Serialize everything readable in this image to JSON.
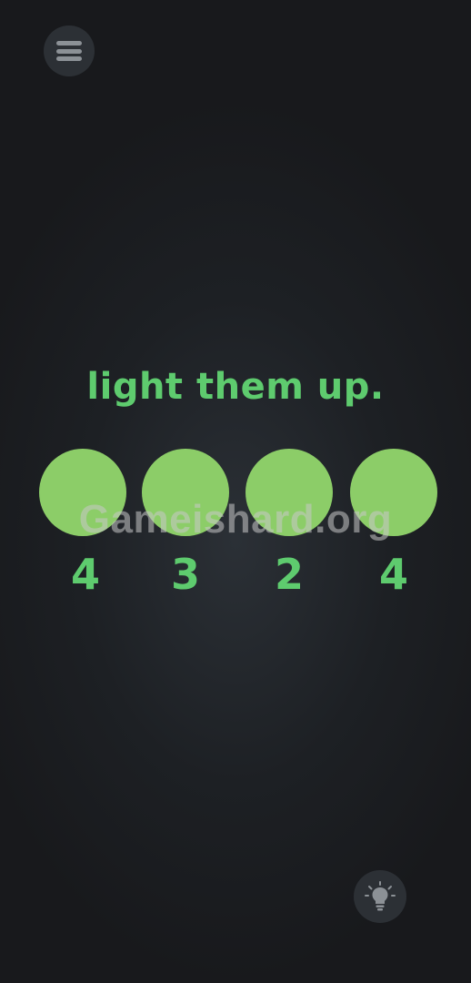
{
  "header": {
    "menu_icon": "menu-icon"
  },
  "puzzle": {
    "title": "light them up.",
    "bulbs": [
      {
        "count": "4",
        "lit": true
      },
      {
        "count": "3",
        "lit": true
      },
      {
        "count": "2",
        "lit": true
      },
      {
        "count": "4",
        "lit": true
      }
    ]
  },
  "watermark": "Gameishard.org",
  "footer": {
    "hint_icon": "lightbulb-icon"
  },
  "colors": {
    "background": "#1d2024",
    "accent_text": "#5ecb6e",
    "bulb_lit": "#8ccd68",
    "button_bg": "#2c3035",
    "icon_gray": "#8c9196"
  }
}
